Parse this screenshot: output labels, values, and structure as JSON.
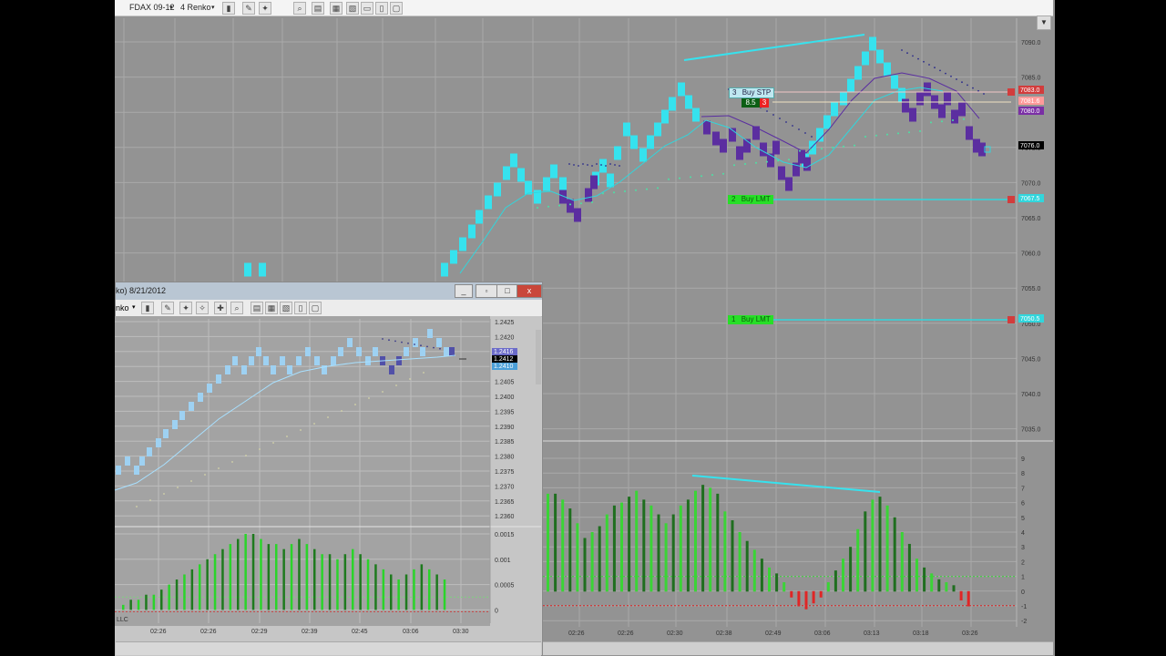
{
  "toolbar": {
    "instrument": "FDAX 09-12",
    "period": "4 Renko"
  },
  "main_chart": {
    "price_ticks": [
      "7090.0",
      "7085.0",
      "7080.0",
      "7075.0",
      "7070.0",
      "7065.0",
      "7060.0",
      "7055.0",
      "7050.0",
      "7045.0",
      "7040.0",
      "7035.0"
    ],
    "osc_ticks": [
      "9",
      "8",
      "7",
      "6",
      "5",
      "4",
      "3",
      "2",
      "1",
      "0",
      "-1",
      "-2"
    ],
    "time_labels": [
      "02:26",
      "02:26",
      "02:30",
      "02:38",
      "02:49",
      "03:06",
      "03:13",
      "03:18",
      "03:26"
    ],
    "price_boxes": [
      {
        "label": "7083.0",
        "color": "#d23c3c"
      },
      {
        "label": "7081.6",
        "color": "#ff9a9a"
      },
      {
        "label": "7080.0",
        "color": "#7a2fa5"
      },
      {
        "label": "7076.0",
        "color": "#000000"
      },
      {
        "label": "7067.5",
        "color": "#31d6dc"
      },
      {
        "label": "7050.5",
        "color": "#31d6dc"
      }
    ],
    "orders": {
      "buy_stp": {
        "qty": "3",
        "label": "Buy STP"
      },
      "position": {
        "value": "8.5",
        "qty": "3"
      },
      "buy_lmt_1": {
        "qty": "2",
        "label": "Buy LMT"
      },
      "buy_lmt_2": {
        "qty": "1",
        "label": "Buy LMT"
      }
    }
  },
  "mini_window": {
    "title": "ko) 8/21/2012",
    "toolbar_label": "nko",
    "price_ticks": [
      "1.2425",
      "1.2420",
      "1.2415",
      "1.2410",
      "1.2405",
      "1.2400",
      "1.2395",
      "1.2390",
      "1.2385",
      "1.2380",
      "1.2375",
      "1.2370",
      "1.2365",
      "1.2360"
    ],
    "price_boxes": [
      "1.2416",
      "1.2412",
      "1.2410"
    ],
    "osc_ticks": [
      "0.0015",
      "0.001",
      "0.0005",
      "0"
    ],
    "time_labels": [
      "02:26",
      "02:26",
      "02:29",
      "02:39",
      "02:45",
      "03:06",
      "03:30"
    ],
    "copyright": "LLC",
    "buttons": {
      "min": "_",
      "max": "□",
      "close": "x"
    }
  },
  "colors": {
    "renko_up": "#36e2ee",
    "renko_down": "#5b2ea0",
    "hist_up": "#3ad436",
    "hist_up_dark": "#1f6e1f",
    "hist_down": "#e02626",
    "line": "#31d6dc",
    "bg": "#939393"
  }
}
